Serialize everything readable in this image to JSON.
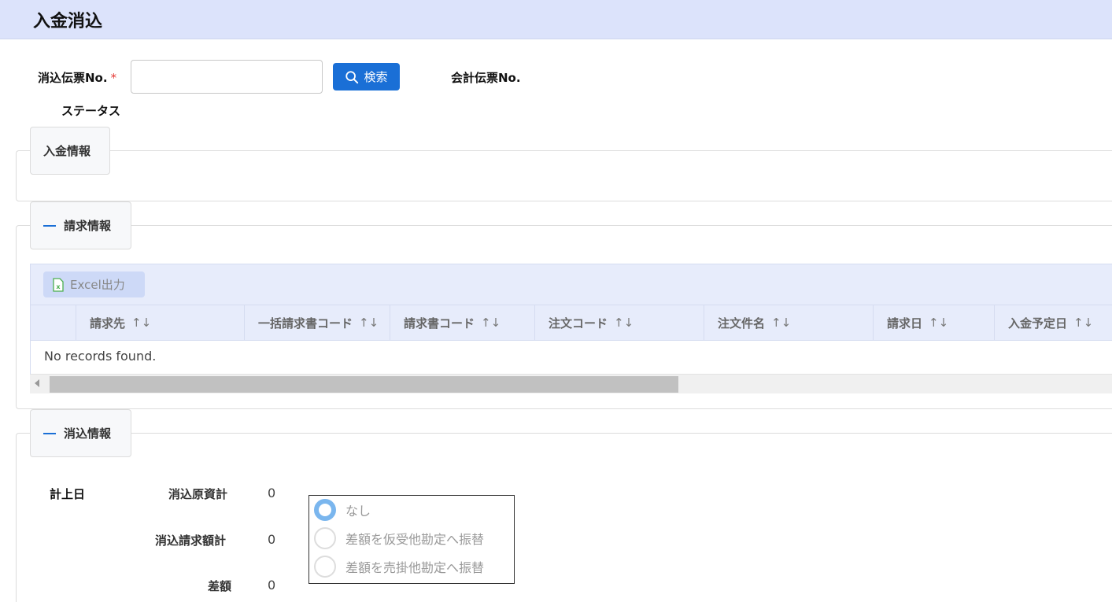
{
  "header": {
    "title": "入金消込"
  },
  "form": {
    "slip_label": "消込伝票No.",
    "required_mark": "*",
    "slip_value": "",
    "search_label": "検索",
    "account_slip_label": "会計伝票No.",
    "status_label": "ステータス"
  },
  "sections": {
    "payment": "入金情報",
    "billing": "請求情報",
    "reconcile": "消込情報"
  },
  "billing_table": {
    "excel_label": "Excel出力",
    "columns": [
      "請求先",
      "一括請求書コード",
      "請求書コード",
      "注文コード",
      "注文件名",
      "請求日",
      "入金予定日"
    ],
    "sort_glyph": "↑↓",
    "empty_message": "No records found."
  },
  "reconcile": {
    "date_label": "計上日",
    "source_total_label": "消込原資計",
    "source_total_value": "0",
    "billing_total_label": "消込請求額計",
    "billing_total_value": "0",
    "diff_label": "差額",
    "diff_value": "0",
    "options": [
      "なし",
      "差額を仮受他勘定へ振替",
      "差額を売掛他勘定へ振替"
    ],
    "selected_option": "なし"
  },
  "colors": {
    "header_bg": "#dce3fb",
    "primary": "#1a6fd6",
    "required": "#e53935"
  }
}
